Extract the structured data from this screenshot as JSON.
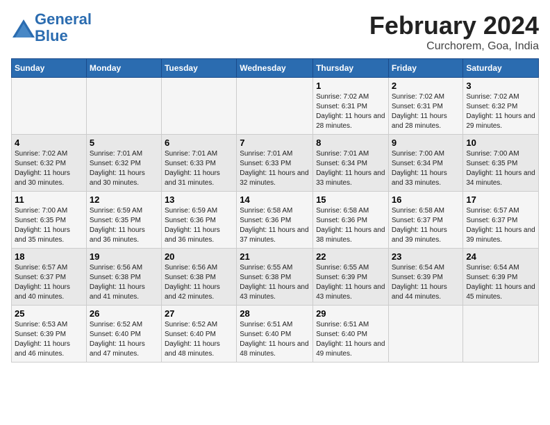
{
  "logo": {
    "line1": "General",
    "line2": "Blue"
  },
  "title": "February 2024",
  "subtitle": "Curchorem, Goa, India",
  "days_of_week": [
    "Sunday",
    "Monday",
    "Tuesday",
    "Wednesday",
    "Thursday",
    "Friday",
    "Saturday"
  ],
  "weeks": [
    [
      {
        "day": "",
        "info": ""
      },
      {
        "day": "",
        "info": ""
      },
      {
        "day": "",
        "info": ""
      },
      {
        "day": "",
        "info": ""
      },
      {
        "day": "1",
        "info": "Sunrise: 7:02 AM\nSunset: 6:31 PM\nDaylight: 11 hours and 28 minutes."
      },
      {
        "day": "2",
        "info": "Sunrise: 7:02 AM\nSunset: 6:31 PM\nDaylight: 11 hours and 28 minutes."
      },
      {
        "day": "3",
        "info": "Sunrise: 7:02 AM\nSunset: 6:32 PM\nDaylight: 11 hours and 29 minutes."
      }
    ],
    [
      {
        "day": "4",
        "info": "Sunrise: 7:02 AM\nSunset: 6:32 PM\nDaylight: 11 hours and 30 minutes."
      },
      {
        "day": "5",
        "info": "Sunrise: 7:01 AM\nSunset: 6:32 PM\nDaylight: 11 hours and 30 minutes."
      },
      {
        "day": "6",
        "info": "Sunrise: 7:01 AM\nSunset: 6:33 PM\nDaylight: 11 hours and 31 minutes."
      },
      {
        "day": "7",
        "info": "Sunrise: 7:01 AM\nSunset: 6:33 PM\nDaylight: 11 hours and 32 minutes."
      },
      {
        "day": "8",
        "info": "Sunrise: 7:01 AM\nSunset: 6:34 PM\nDaylight: 11 hours and 33 minutes."
      },
      {
        "day": "9",
        "info": "Sunrise: 7:00 AM\nSunset: 6:34 PM\nDaylight: 11 hours and 33 minutes."
      },
      {
        "day": "10",
        "info": "Sunrise: 7:00 AM\nSunset: 6:35 PM\nDaylight: 11 hours and 34 minutes."
      }
    ],
    [
      {
        "day": "11",
        "info": "Sunrise: 7:00 AM\nSunset: 6:35 PM\nDaylight: 11 hours and 35 minutes."
      },
      {
        "day": "12",
        "info": "Sunrise: 6:59 AM\nSunset: 6:35 PM\nDaylight: 11 hours and 36 minutes."
      },
      {
        "day": "13",
        "info": "Sunrise: 6:59 AM\nSunset: 6:36 PM\nDaylight: 11 hours and 36 minutes."
      },
      {
        "day": "14",
        "info": "Sunrise: 6:58 AM\nSunset: 6:36 PM\nDaylight: 11 hours and 37 minutes."
      },
      {
        "day": "15",
        "info": "Sunrise: 6:58 AM\nSunset: 6:36 PM\nDaylight: 11 hours and 38 minutes."
      },
      {
        "day": "16",
        "info": "Sunrise: 6:58 AM\nSunset: 6:37 PM\nDaylight: 11 hours and 39 minutes."
      },
      {
        "day": "17",
        "info": "Sunrise: 6:57 AM\nSunset: 6:37 PM\nDaylight: 11 hours and 39 minutes."
      }
    ],
    [
      {
        "day": "18",
        "info": "Sunrise: 6:57 AM\nSunset: 6:37 PM\nDaylight: 11 hours and 40 minutes."
      },
      {
        "day": "19",
        "info": "Sunrise: 6:56 AM\nSunset: 6:38 PM\nDaylight: 11 hours and 41 minutes."
      },
      {
        "day": "20",
        "info": "Sunrise: 6:56 AM\nSunset: 6:38 PM\nDaylight: 11 hours and 42 minutes."
      },
      {
        "day": "21",
        "info": "Sunrise: 6:55 AM\nSunset: 6:38 PM\nDaylight: 11 hours and 43 minutes."
      },
      {
        "day": "22",
        "info": "Sunrise: 6:55 AM\nSunset: 6:39 PM\nDaylight: 11 hours and 43 minutes."
      },
      {
        "day": "23",
        "info": "Sunrise: 6:54 AM\nSunset: 6:39 PM\nDaylight: 11 hours and 44 minutes."
      },
      {
        "day": "24",
        "info": "Sunrise: 6:54 AM\nSunset: 6:39 PM\nDaylight: 11 hours and 45 minutes."
      }
    ],
    [
      {
        "day": "25",
        "info": "Sunrise: 6:53 AM\nSunset: 6:39 PM\nDaylight: 11 hours and 46 minutes."
      },
      {
        "day": "26",
        "info": "Sunrise: 6:52 AM\nSunset: 6:40 PM\nDaylight: 11 hours and 47 minutes."
      },
      {
        "day": "27",
        "info": "Sunrise: 6:52 AM\nSunset: 6:40 PM\nDaylight: 11 hours and 48 minutes."
      },
      {
        "day": "28",
        "info": "Sunrise: 6:51 AM\nSunset: 6:40 PM\nDaylight: 11 hours and 48 minutes."
      },
      {
        "day": "29",
        "info": "Sunrise: 6:51 AM\nSunset: 6:40 PM\nDaylight: 11 hours and 49 minutes."
      },
      {
        "day": "",
        "info": ""
      },
      {
        "day": "",
        "info": ""
      }
    ]
  ]
}
